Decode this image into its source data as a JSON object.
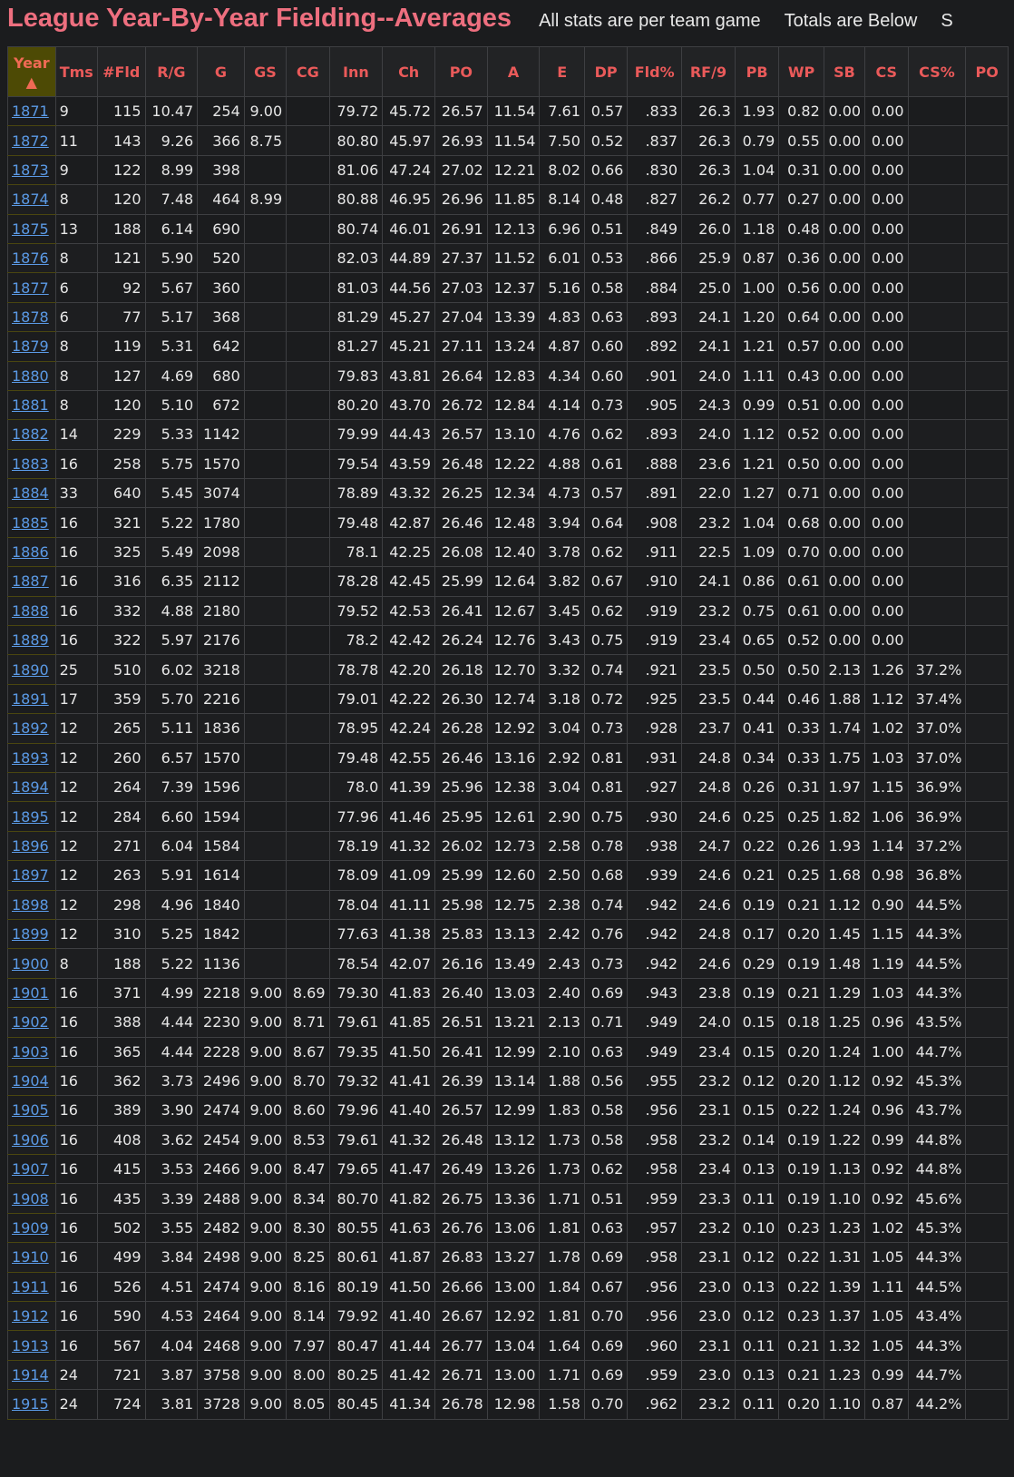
{
  "header": {
    "title": "League Year-By-Year Fielding--Averages",
    "note1": "All stats are per team game",
    "note2": "Totals are Below",
    "note3": "S"
  },
  "table": {
    "sort_indicator": "▲",
    "columns": [
      "Year",
      "Tms",
      "#Fld",
      "R/G",
      "G",
      "GS",
      "CG",
      "Inn",
      "Ch",
      "PO",
      "A",
      "E",
      "DP",
      "Fld%",
      "RF/9",
      "PB",
      "WP",
      "SB",
      "CS",
      "CS%",
      "PO"
    ],
    "rows": [
      [
        "1871",
        "9",
        "115",
        "10.47",
        "254",
        "9.00",
        "",
        "79.72",
        "45.72",
        "26.57",
        "11.54",
        "7.61",
        "0.57",
        ".833",
        "26.3",
        "1.93",
        "0.82",
        "0.00",
        "0.00",
        "",
        ""
      ],
      [
        "1872",
        "11",
        "143",
        "9.26",
        "366",
        "8.75",
        "",
        "80.80",
        "45.97",
        "26.93",
        "11.54",
        "7.50",
        "0.52",
        ".837",
        "26.3",
        "0.79",
        "0.55",
        "0.00",
        "0.00",
        "",
        ""
      ],
      [
        "1873",
        "9",
        "122",
        "8.99",
        "398",
        "",
        "",
        "81.06",
        "47.24",
        "27.02",
        "12.21",
        "8.02",
        "0.66",
        ".830",
        "26.3",
        "1.04",
        "0.31",
        "0.00",
        "0.00",
        "",
        ""
      ],
      [
        "1874",
        "8",
        "120",
        "7.48",
        "464",
        "8.99",
        "",
        "80.88",
        "46.95",
        "26.96",
        "11.85",
        "8.14",
        "0.48",
        ".827",
        "26.2",
        "0.77",
        "0.27",
        "0.00",
        "0.00",
        "",
        ""
      ],
      [
        "1875",
        "13",
        "188",
        "6.14",
        "690",
        "",
        "",
        "80.74",
        "46.01",
        "26.91",
        "12.13",
        "6.96",
        "0.51",
        ".849",
        "26.0",
        "1.18",
        "0.48",
        "0.00",
        "0.00",
        "",
        ""
      ],
      [
        "1876",
        "8",
        "121",
        "5.90",
        "520",
        "",
        "",
        "82.03",
        "44.89",
        "27.37",
        "11.52",
        "6.01",
        "0.53",
        ".866",
        "25.9",
        "0.87",
        "0.36",
        "0.00",
        "0.00",
        "",
        ""
      ],
      [
        "1877",
        "6",
        "92",
        "5.67",
        "360",
        "",
        "",
        "81.03",
        "44.56",
        "27.03",
        "12.37",
        "5.16",
        "0.58",
        ".884",
        "25.0",
        "1.00",
        "0.56",
        "0.00",
        "0.00",
        "",
        ""
      ],
      [
        "1878",
        "6",
        "77",
        "5.17",
        "368",
        "",
        "",
        "81.29",
        "45.27",
        "27.04",
        "13.39",
        "4.83",
        "0.63",
        ".893",
        "24.1",
        "1.20",
        "0.64",
        "0.00",
        "0.00",
        "",
        ""
      ],
      [
        "1879",
        "8",
        "119",
        "5.31",
        "642",
        "",
        "",
        "81.27",
        "45.21",
        "27.11",
        "13.24",
        "4.87",
        "0.60",
        ".892",
        "24.1",
        "1.21",
        "0.57",
        "0.00",
        "0.00",
        "",
        ""
      ],
      [
        "1880",
        "8",
        "127",
        "4.69",
        "680",
        "",
        "",
        "79.83",
        "43.81",
        "26.64",
        "12.83",
        "4.34",
        "0.60",
        ".901",
        "24.0",
        "1.11",
        "0.43",
        "0.00",
        "0.00",
        "",
        ""
      ],
      [
        "1881",
        "8",
        "120",
        "5.10",
        "672",
        "",
        "",
        "80.20",
        "43.70",
        "26.72",
        "12.84",
        "4.14",
        "0.73",
        ".905",
        "24.3",
        "0.99",
        "0.51",
        "0.00",
        "0.00",
        "",
        ""
      ],
      [
        "1882",
        "14",
        "229",
        "5.33",
        "1142",
        "",
        "",
        "79.99",
        "44.43",
        "26.57",
        "13.10",
        "4.76",
        "0.62",
        ".893",
        "24.0",
        "1.12",
        "0.52",
        "0.00",
        "0.00",
        "",
        ""
      ],
      [
        "1883",
        "16",
        "258",
        "5.75",
        "1570",
        "",
        "",
        "79.54",
        "43.59",
        "26.48",
        "12.22",
        "4.88",
        "0.61",
        ".888",
        "23.6",
        "1.21",
        "0.50",
        "0.00",
        "0.00",
        "",
        ""
      ],
      [
        "1884",
        "33",
        "640",
        "5.45",
        "3074",
        "",
        "",
        "78.89",
        "43.32",
        "26.25",
        "12.34",
        "4.73",
        "0.57",
        ".891",
        "22.0",
        "1.27",
        "0.71",
        "0.00",
        "0.00",
        "",
        ""
      ],
      [
        "1885",
        "16",
        "321",
        "5.22",
        "1780",
        "",
        "",
        "79.48",
        "42.87",
        "26.46",
        "12.48",
        "3.94",
        "0.64",
        ".908",
        "23.2",
        "1.04",
        "0.68",
        "0.00",
        "0.00",
        "",
        ""
      ],
      [
        "1886",
        "16",
        "325",
        "5.49",
        "2098",
        "",
        "",
        "78.1",
        "42.25",
        "26.08",
        "12.40",
        "3.78",
        "0.62",
        ".911",
        "22.5",
        "1.09",
        "0.70",
        "0.00",
        "0.00",
        "",
        ""
      ],
      [
        "1887",
        "16",
        "316",
        "6.35",
        "2112",
        "",
        "",
        "78.28",
        "42.45",
        "25.99",
        "12.64",
        "3.82",
        "0.67",
        ".910",
        "24.1",
        "0.86",
        "0.61",
        "0.00",
        "0.00",
        "",
        ""
      ],
      [
        "1888",
        "16",
        "332",
        "4.88",
        "2180",
        "",
        "",
        "79.52",
        "42.53",
        "26.41",
        "12.67",
        "3.45",
        "0.62",
        ".919",
        "23.2",
        "0.75",
        "0.61",
        "0.00",
        "0.00",
        "",
        ""
      ],
      [
        "1889",
        "16",
        "322",
        "5.97",
        "2176",
        "",
        "",
        "78.2",
        "42.42",
        "26.24",
        "12.76",
        "3.43",
        "0.75",
        ".919",
        "23.4",
        "0.65",
        "0.52",
        "0.00",
        "0.00",
        "",
        ""
      ],
      [
        "1890",
        "25",
        "510",
        "6.02",
        "3218",
        "",
        "",
        "78.78",
        "42.20",
        "26.18",
        "12.70",
        "3.32",
        "0.74",
        ".921",
        "23.5",
        "0.50",
        "0.50",
        "2.13",
        "1.26",
        "37.2%",
        ""
      ],
      [
        "1891",
        "17",
        "359",
        "5.70",
        "2216",
        "",
        "",
        "79.01",
        "42.22",
        "26.30",
        "12.74",
        "3.18",
        "0.72",
        ".925",
        "23.5",
        "0.44",
        "0.46",
        "1.88",
        "1.12",
        "37.4%",
        ""
      ],
      [
        "1892",
        "12",
        "265",
        "5.11",
        "1836",
        "",
        "",
        "78.95",
        "42.24",
        "26.28",
        "12.92",
        "3.04",
        "0.73",
        ".928",
        "23.7",
        "0.41",
        "0.33",
        "1.74",
        "1.02",
        "37.0%",
        ""
      ],
      [
        "1893",
        "12",
        "260",
        "6.57",
        "1570",
        "",
        "",
        "79.48",
        "42.55",
        "26.46",
        "13.16",
        "2.92",
        "0.81",
        ".931",
        "24.8",
        "0.34",
        "0.33",
        "1.75",
        "1.03",
        "37.0%",
        ""
      ],
      [
        "1894",
        "12",
        "264",
        "7.39",
        "1596",
        "",
        "",
        "78.0",
        "41.39",
        "25.96",
        "12.38",
        "3.04",
        "0.81",
        ".927",
        "24.8",
        "0.26",
        "0.31",
        "1.97",
        "1.15",
        "36.9%",
        ""
      ],
      [
        "1895",
        "12",
        "284",
        "6.60",
        "1594",
        "",
        "",
        "77.96",
        "41.46",
        "25.95",
        "12.61",
        "2.90",
        "0.75",
        ".930",
        "24.6",
        "0.25",
        "0.25",
        "1.82",
        "1.06",
        "36.9%",
        ""
      ],
      [
        "1896",
        "12",
        "271",
        "6.04",
        "1584",
        "",
        "",
        "78.19",
        "41.32",
        "26.02",
        "12.73",
        "2.58",
        "0.78",
        ".938",
        "24.7",
        "0.22",
        "0.26",
        "1.93",
        "1.14",
        "37.2%",
        ""
      ],
      [
        "1897",
        "12",
        "263",
        "5.91",
        "1614",
        "",
        "",
        "78.09",
        "41.09",
        "25.99",
        "12.60",
        "2.50",
        "0.68",
        ".939",
        "24.6",
        "0.21",
        "0.25",
        "1.68",
        "0.98",
        "36.8%",
        ""
      ],
      [
        "1898",
        "12",
        "298",
        "4.96",
        "1840",
        "",
        "",
        "78.04",
        "41.11",
        "25.98",
        "12.75",
        "2.38",
        "0.74",
        ".942",
        "24.6",
        "0.19",
        "0.21",
        "1.12",
        "0.90",
        "44.5%",
        ""
      ],
      [
        "1899",
        "12",
        "310",
        "5.25",
        "1842",
        "",
        "",
        "77.63",
        "41.38",
        "25.83",
        "13.13",
        "2.42",
        "0.76",
        ".942",
        "24.8",
        "0.17",
        "0.20",
        "1.45",
        "1.15",
        "44.3%",
        ""
      ],
      [
        "1900",
        "8",
        "188",
        "5.22",
        "1136",
        "",
        "",
        "78.54",
        "42.07",
        "26.16",
        "13.49",
        "2.43",
        "0.73",
        ".942",
        "24.6",
        "0.29",
        "0.19",
        "1.48",
        "1.19",
        "44.5%",
        ""
      ],
      [
        "1901",
        "16",
        "371",
        "4.99",
        "2218",
        "9.00",
        "8.69",
        "79.30",
        "41.83",
        "26.40",
        "13.03",
        "2.40",
        "0.69",
        ".943",
        "23.8",
        "0.19",
        "0.21",
        "1.29",
        "1.03",
        "44.3%",
        ""
      ],
      [
        "1902",
        "16",
        "388",
        "4.44",
        "2230",
        "9.00",
        "8.71",
        "79.61",
        "41.85",
        "26.51",
        "13.21",
        "2.13",
        "0.71",
        ".949",
        "24.0",
        "0.15",
        "0.18",
        "1.25",
        "0.96",
        "43.5%",
        ""
      ],
      [
        "1903",
        "16",
        "365",
        "4.44",
        "2228",
        "9.00",
        "8.67",
        "79.35",
        "41.50",
        "26.41",
        "12.99",
        "2.10",
        "0.63",
        ".949",
        "23.4",
        "0.15",
        "0.20",
        "1.24",
        "1.00",
        "44.7%",
        ""
      ],
      [
        "1904",
        "16",
        "362",
        "3.73",
        "2496",
        "9.00",
        "8.70",
        "79.32",
        "41.41",
        "26.39",
        "13.14",
        "1.88",
        "0.56",
        ".955",
        "23.2",
        "0.12",
        "0.20",
        "1.12",
        "0.92",
        "45.3%",
        ""
      ],
      [
        "1905",
        "16",
        "389",
        "3.90",
        "2474",
        "9.00",
        "8.60",
        "79.96",
        "41.40",
        "26.57",
        "12.99",
        "1.83",
        "0.58",
        ".956",
        "23.1",
        "0.15",
        "0.22",
        "1.24",
        "0.96",
        "43.7%",
        ""
      ],
      [
        "1906",
        "16",
        "408",
        "3.62",
        "2454",
        "9.00",
        "8.53",
        "79.61",
        "41.32",
        "26.48",
        "13.12",
        "1.73",
        "0.58",
        ".958",
        "23.2",
        "0.14",
        "0.19",
        "1.22",
        "0.99",
        "44.8%",
        ""
      ],
      [
        "1907",
        "16",
        "415",
        "3.53",
        "2466",
        "9.00",
        "8.47",
        "79.65",
        "41.47",
        "26.49",
        "13.26",
        "1.73",
        "0.62",
        ".958",
        "23.4",
        "0.13",
        "0.19",
        "1.13",
        "0.92",
        "44.8%",
        ""
      ],
      [
        "1908",
        "16",
        "435",
        "3.39",
        "2488",
        "9.00",
        "8.34",
        "80.70",
        "41.82",
        "26.75",
        "13.36",
        "1.71",
        "0.51",
        ".959",
        "23.3",
        "0.11",
        "0.19",
        "1.10",
        "0.92",
        "45.6%",
        ""
      ],
      [
        "1909",
        "16",
        "502",
        "3.55",
        "2482",
        "9.00",
        "8.30",
        "80.55",
        "41.63",
        "26.76",
        "13.06",
        "1.81",
        "0.63",
        ".957",
        "23.2",
        "0.10",
        "0.23",
        "1.23",
        "1.02",
        "45.3%",
        ""
      ],
      [
        "1910",
        "16",
        "499",
        "3.84",
        "2498",
        "9.00",
        "8.25",
        "80.61",
        "41.87",
        "26.83",
        "13.27",
        "1.78",
        "0.69",
        ".958",
        "23.1",
        "0.12",
        "0.22",
        "1.31",
        "1.05",
        "44.3%",
        ""
      ],
      [
        "1911",
        "16",
        "526",
        "4.51",
        "2474",
        "9.00",
        "8.16",
        "80.19",
        "41.50",
        "26.66",
        "13.00",
        "1.84",
        "0.67",
        ".956",
        "23.0",
        "0.13",
        "0.22",
        "1.39",
        "1.11",
        "44.5%",
        ""
      ],
      [
        "1912",
        "16",
        "590",
        "4.53",
        "2464",
        "9.00",
        "8.14",
        "79.92",
        "41.40",
        "26.67",
        "12.92",
        "1.81",
        "0.70",
        ".956",
        "23.0",
        "0.12",
        "0.23",
        "1.37",
        "1.05",
        "43.4%",
        ""
      ],
      [
        "1913",
        "16",
        "567",
        "4.04",
        "2468",
        "9.00",
        "7.97",
        "80.47",
        "41.44",
        "26.77",
        "13.04",
        "1.64",
        "0.69",
        ".960",
        "23.1",
        "0.11",
        "0.21",
        "1.32",
        "1.05",
        "44.3%",
        ""
      ],
      [
        "1914",
        "24",
        "721",
        "3.87",
        "3758",
        "9.00",
        "8.00",
        "80.25",
        "41.42",
        "26.71",
        "13.00",
        "1.71",
        "0.69",
        ".959",
        "23.0",
        "0.13",
        "0.21",
        "1.23",
        "0.99",
        "44.7%",
        ""
      ],
      [
        "1915",
        "24",
        "724",
        "3.81",
        "3728",
        "9.00",
        "8.05",
        "80.45",
        "41.34",
        "26.78",
        "12.98",
        "1.58",
        "0.70",
        ".962",
        "23.2",
        "0.11",
        "0.20",
        "1.10",
        "0.87",
        "44.2%",
        ""
      ]
    ]
  }
}
